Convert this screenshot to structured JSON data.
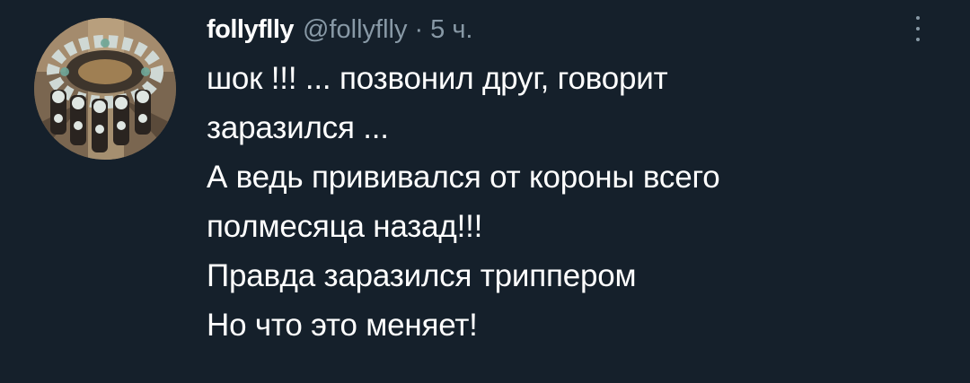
{
  "tweet": {
    "display_name": "follyflly",
    "handle": "@follyflly",
    "separator": "·",
    "time": "5 ч.",
    "lines": [
      "шок !!! ... позвонил друг, говорит",
      "заразился ...",
      "А ведь прививался от короны всего",
      "полмесяца назад!!!",
      "Правда заразился триппером",
      "Но что это меняет!"
    ]
  },
  "icons": {
    "more": "more-vertical-icon",
    "avatar": "avatar-image"
  },
  "colors": {
    "background": "#15202b",
    "primary_text": "#ffffff",
    "secondary_text": "#8899a6"
  }
}
